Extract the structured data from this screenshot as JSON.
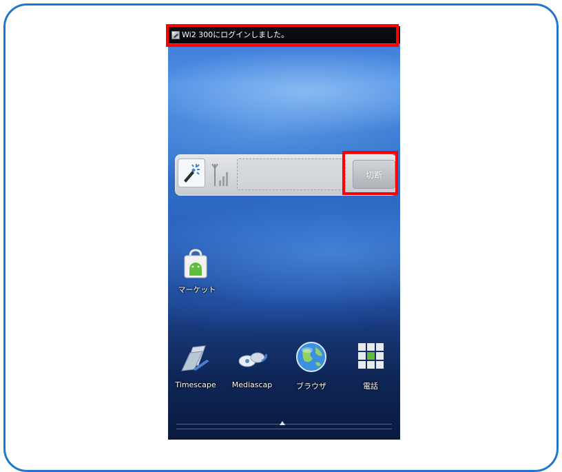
{
  "status_bar": {
    "notification_icon": "wifi-login-icon",
    "notification_text": "Wi2 300にログインしました。"
  },
  "widget": {
    "app_icon": "wi2-connect-icon",
    "signal_icon": "signal-strength-icon",
    "disconnect_label": "切断"
  },
  "home": {
    "market": {
      "label": "マーケット",
      "icon": "market-bag-icon"
    }
  },
  "dock": {
    "items": [
      {
        "label": "Timescape",
        "icon": "timescape-icon"
      },
      {
        "label": "Mediascap",
        "icon": "mediascape-icon"
      },
      {
        "label": "ブラウザ",
        "icon": "globe-icon"
      },
      {
        "label": "電話",
        "icon": "phone-keypad-icon"
      }
    ]
  },
  "colors": {
    "frame_border": "#1e77c9",
    "highlight": "#ff0000",
    "status_bar": "#0b0c10"
  }
}
